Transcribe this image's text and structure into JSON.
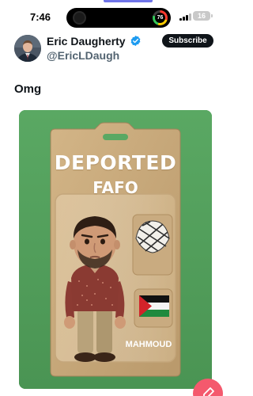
{
  "status_bar": {
    "time": "7:46",
    "activity_ring_value": "76",
    "battery_level": "16"
  },
  "tweet": {
    "author_name": "Eric Daugherty",
    "author_handle": "@EricLDaugh",
    "subscribe_label": "Subscribe",
    "text": "Omg",
    "media": {
      "card_title": "DEPORTED",
      "card_subtitle": "FAFO",
      "figure_name": "MAHMOUD",
      "accessory_icons": [
        "keffiyeh-icon",
        "palestinian-flag-icon"
      ]
    }
  },
  "fab": {
    "icon": "compose-icon"
  },
  "colors": {
    "subscribe_bg": "#0f1419",
    "verified_badge": "#1d9bf0",
    "fab": "#f4596d",
    "media_bg": "#56a15f",
    "card_bg": "#c8a97c",
    "tab_indicator": "#6f74e8"
  }
}
